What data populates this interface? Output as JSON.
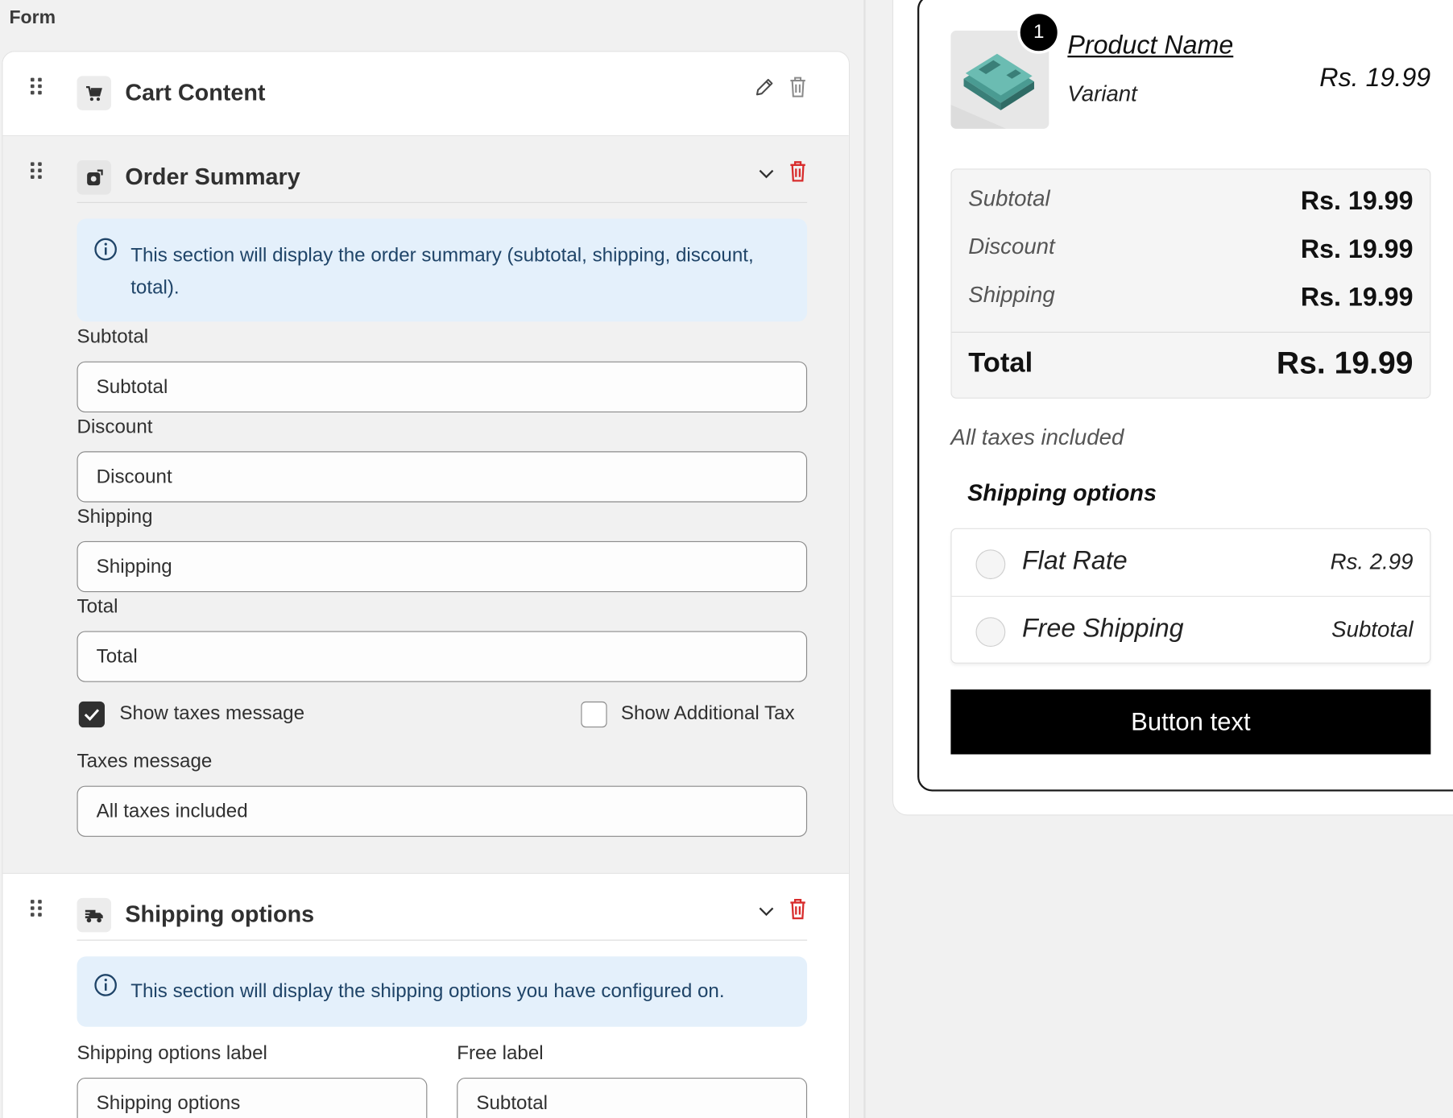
{
  "form": {
    "title": "Form",
    "sections": {
      "cart": {
        "title": "Cart Content"
      },
      "order": {
        "title": "Order Summary",
        "info": "This section will display the order summary (subtotal, shipping, discount, total).",
        "fields": {
          "subtotal": {
            "label": "Subtotal",
            "value": "Subtotal"
          },
          "discount": {
            "label": "Discount",
            "value": "Discount"
          },
          "shipping": {
            "label": "Shipping",
            "value": "Shipping"
          },
          "total": {
            "label": "Total",
            "value": "Total"
          }
        },
        "show_taxes": {
          "label": "Show taxes message",
          "checked": true
        },
        "show_additional_tax": {
          "label": "Show Additional Tax",
          "checked": false
        },
        "taxes_message": {
          "label": "Taxes message",
          "value": "All taxes included"
        }
      },
      "shipping": {
        "title": "Shipping options",
        "info": "This section will display the shipping options you have configured on.",
        "options_label": {
          "label": "Shipping options label",
          "value": "Shipping options"
        },
        "free_label": {
          "label": "Free label",
          "value": "Subtotal"
        }
      }
    }
  },
  "preview": {
    "product": {
      "badge": "1",
      "name": "Product Name",
      "variant": "Variant",
      "price": "Rs. 19.99"
    },
    "summary": {
      "subtotal": {
        "label": "Subtotal",
        "value": "Rs. 19.99"
      },
      "discount": {
        "label": "Discount",
        "value": "Rs. 19.99"
      },
      "shipping": {
        "label": "Shipping",
        "value": "Rs. 19.99"
      },
      "total": {
        "label": "Total",
        "value": "Rs. 19.99"
      }
    },
    "taxes_message": "All taxes included",
    "shipping_heading": "Shipping options",
    "options": [
      {
        "name": "Flat Rate",
        "price": "Rs. 2.99"
      },
      {
        "name": "Free Shipping",
        "price": "Subtotal"
      }
    ],
    "button": "Button text"
  },
  "colors": {
    "danger": "#d82c2c",
    "info_bg": "#e4f0fb",
    "info_text": "#1f4468",
    "cta": "#000000"
  },
  "icons": [
    "drag-handle-icon",
    "cart-icon",
    "order-icon",
    "truck-icon",
    "pencil-icon",
    "trash-icon",
    "chevron-down-icon",
    "info-icon"
  ]
}
